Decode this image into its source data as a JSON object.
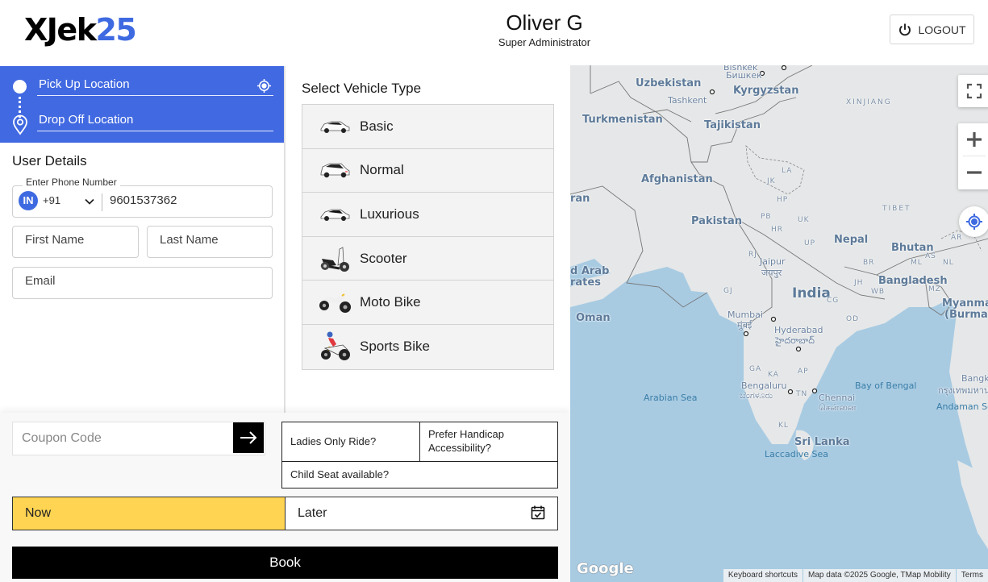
{
  "header": {
    "logo_text_dark": "XJek",
    "logo_text_accent": "25",
    "user_name": "Oliver G",
    "user_role": "Super Administrator",
    "logout_label": "LOGOUT",
    "logout_icon": "power-icon"
  },
  "location": {
    "pickup_placeholder": "Pick Up Location",
    "dropoff_placeholder": "Drop Off Location",
    "pickup_icon": "filled-circle-icon",
    "dropoff_icon": "map-pin-icon",
    "current_location_icon": "crosshair-icon"
  },
  "user_details": {
    "title": "User Details",
    "phone_label": "Enter Phone Number",
    "country_flag": "IN",
    "country_code": "+91",
    "phone_value": "9601537362",
    "first_name_placeholder": "First Name",
    "last_name_placeholder": "Last Name",
    "email_placeholder": "Email"
  },
  "vehicles": {
    "title": "Select Vehicle Type",
    "items": [
      {
        "label": "Basic",
        "icon": "car-icon"
      },
      {
        "label": "Normal",
        "icon": "suv-icon"
      },
      {
        "label": "Luxurious",
        "icon": "luxury-car-icon"
      },
      {
        "label": "Scooter",
        "icon": "scooter-icon"
      },
      {
        "label": "Moto Bike",
        "icon": "motorbike-icon"
      },
      {
        "label": "Sports Bike",
        "icon": "sports-bike-icon"
      }
    ]
  },
  "booking": {
    "coupon_placeholder": "Coupon Code",
    "coupon_apply_icon": "arrow-right-icon",
    "ladies_only": "Ladies Only Ride?",
    "handicap": "Prefer Handicap Accessibility?",
    "child_seat": "Child Seat available?",
    "now_label": "Now",
    "later_label": "Later",
    "book_label": "Book",
    "accent_color": "#ffd452"
  },
  "map": {
    "labels": {
      "uzbekistan": "Uzbekistan",
      "kyrgyzstan": "Kyrgyzstan",
      "bishkek": "Bishkek",
      "bishkek_local": "Бишкек",
      "tashkent": "Tashkent",
      "turkmenistan": "Turkmenistan",
      "tajikistan": "Tajikistan",
      "xinjiang": "XINJIANG",
      "afghanistan": "Afghanistan",
      "iran": "ran",
      "pakistan": "Pakistan",
      "tibet": "TIBET",
      "nepal": "Nepal",
      "bhutan": "Bhutan",
      "uae_1": "d Arab",
      "uae_2": "rates",
      "oman": "Oman",
      "india": "India",
      "bangladesh": "Bangladesh",
      "myanmar_1": "Myanmar",
      "myanmar_2": "(Burma)",
      "jaipur": "Jaipur",
      "jaipur_local": "जयपुर",
      "mumbai": "Mumbai",
      "mumbai_local": "मुंबई",
      "hyderabad": "Hyderabad",
      "hyderabad_local": "హైదరాబాద్",
      "bengaluru": "Bengaluru",
      "bengaluru_local": "ಬೆಂಗಳೂರು",
      "chennai": "Chennai",
      "chennai_local": "சென்னை",
      "arabian_sea": "Arabian Sea",
      "bay_of_bengal": "Bay of Bengal",
      "andaman_sea": "Andaman Sea",
      "laccadive_sea": "Laccadive Sea",
      "sri_lanka": "Sri Lanka",
      "bangkok": "Bangk",
      "bangkok_local": "กรุงเทพมหาน",
      "st_la": "LA",
      "st_jk": "JK",
      "st_hp": "HP",
      "st_pb": "PB",
      "st_uk": "UK",
      "st_hr": "HR",
      "st_up": "UP",
      "st_rj": "RJ",
      "st_gj": "GJ",
      "st_br": "BR",
      "st_jh": "JH",
      "st_wb": "WB",
      "st_cg": "CG",
      "st_od": "OD",
      "st_as": "AS",
      "st_ml": "ML",
      "st_nl": "NL",
      "st_mz": "MZ",
      "st_ar": "AR",
      "st_ga": "GA",
      "st_ka": "KA",
      "st_ap": "AP",
      "st_tn": "TN",
      "st_kl": "KL"
    },
    "google_logo": "Google",
    "attribution": [
      "Keyboard shortcuts",
      "Map data ©2025 Google, TMap Mobility",
      "Terms"
    ],
    "controls": [
      "fullscreen-icon",
      "zoom-in-icon",
      "zoom-out-icon",
      "my-location-icon"
    ],
    "water_color": "#a8cbe2",
    "land_color": "#e5e7e8"
  }
}
